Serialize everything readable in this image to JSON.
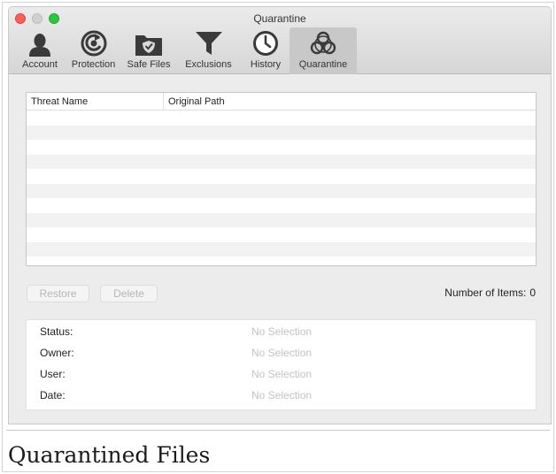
{
  "window": {
    "title": "Quarantine",
    "colors": {
      "close": "#fc5f57",
      "minimize": "#d0d0d0",
      "maximize": "#2ac840"
    }
  },
  "toolbar": {
    "tabs": [
      {
        "label": "Account",
        "icon": "user-icon"
      },
      {
        "label": "Protection",
        "icon": "protection-icon"
      },
      {
        "label": "Safe Files",
        "icon": "safe-files-icon"
      },
      {
        "label": "Exclusions",
        "icon": "filter-icon"
      },
      {
        "label": "History",
        "icon": "clock-icon"
      },
      {
        "label": "Quarantine",
        "icon": "biohazard-icon",
        "active": true
      }
    ]
  },
  "table": {
    "columns": [
      "Threat Name",
      "Original Path"
    ],
    "rows": []
  },
  "actions": {
    "restore_label": "Restore",
    "delete_label": "Delete"
  },
  "summary": {
    "count_label": "Number of Items:",
    "count_value": "0"
  },
  "details": {
    "status_label": "Status:",
    "status_value": "No Selection",
    "owner_label": "Owner:",
    "owner_value": "No Selection",
    "user_label": "User:",
    "user_value": "No Selection",
    "date_label": "Date:",
    "date_value": "No Selection"
  },
  "caption": "Quarantined Files"
}
